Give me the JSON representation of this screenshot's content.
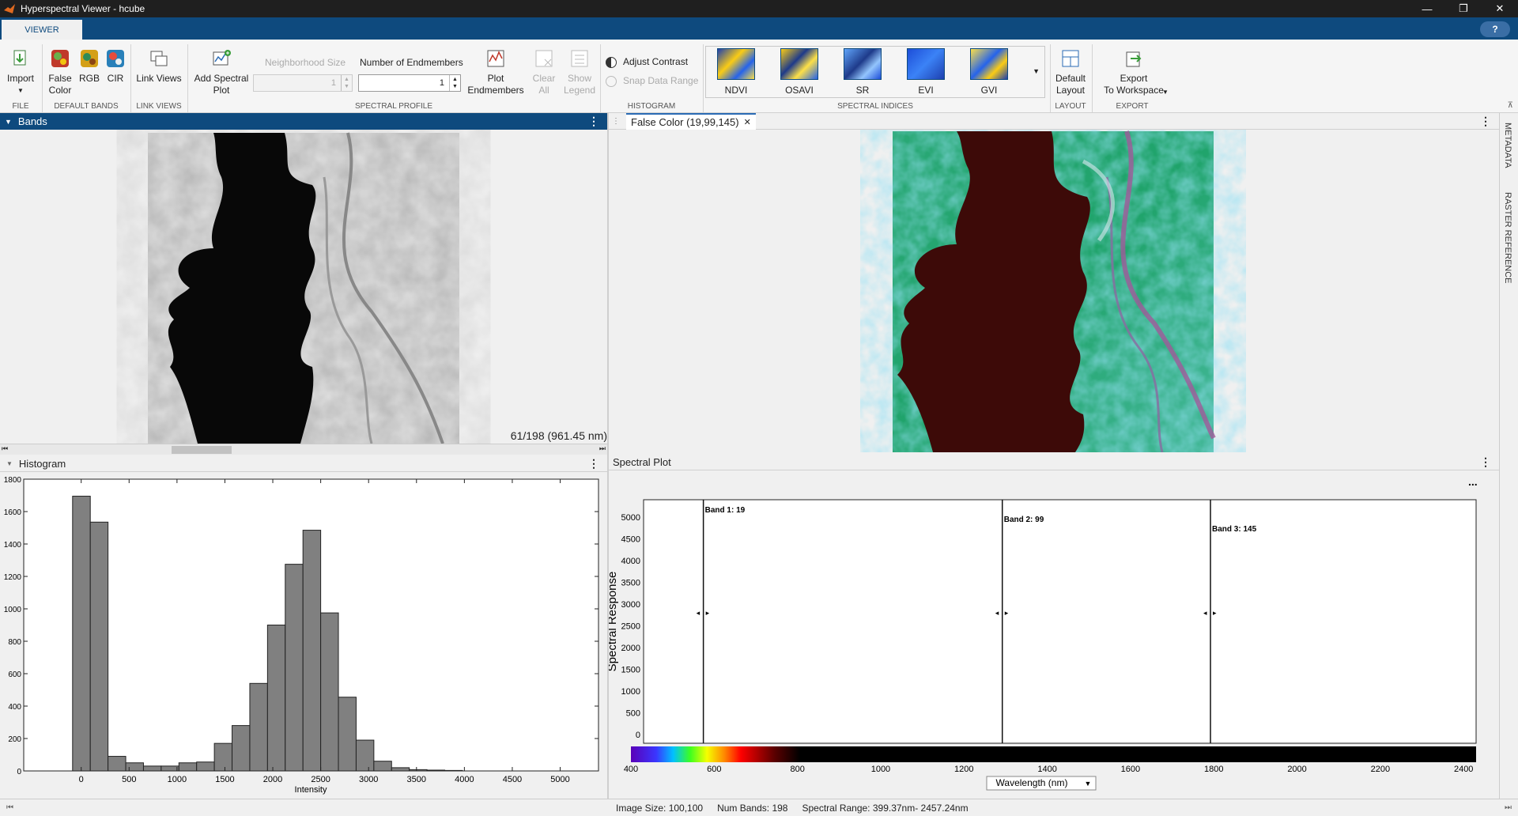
{
  "window": {
    "title": "Hyperspectral Viewer - hcube",
    "min_glyph": "—",
    "max_glyph": "❐",
    "close_glyph": "✕"
  },
  "tabs": {
    "viewer": "VIEWER",
    "help": "?"
  },
  "ribbon": {
    "import": "Import",
    "false_color": "False\nColor",
    "rgb": "RGB",
    "cir": "CIR",
    "link_views": "Link Views",
    "add_spectral_plot": "Add Spectral\nPlot",
    "neighborhood_size": "Neighborhood Size",
    "neighborhood_value": "1",
    "num_endmembers": "Number of Endmembers",
    "num_endmembers_value": "1",
    "plot_endmembers": "Plot\nEndmembers",
    "clear_all": "Clear\nAll",
    "show_legend": "Show\nLegend",
    "adjust_contrast": "Adjust Contrast",
    "snap_data_range": "Snap Data Range",
    "indices": [
      "NDVI",
      "OSAVI",
      "SR",
      "EVI",
      "GVI"
    ],
    "default_layout": "Default\nLayout",
    "export": "Export\nTo Workspace",
    "groups": {
      "file": "FILE",
      "default_bands": "DEFAULT BANDS",
      "link_views": "LINK VIEWS",
      "spectral_profile": "SPECTRAL PROFILE",
      "histogram": "HISTOGRAM",
      "spectral_indices": "SPECTRAL INDICES",
      "layout": "LAYOUT",
      "export": "EXPORT"
    }
  },
  "bands_panel": {
    "title": "Bands",
    "band_label": "61/198 (961.45 nm)"
  },
  "false_color_panel": {
    "tab_label": "False Color (19,99,145)"
  },
  "histogram_panel": {
    "title": "Histogram"
  },
  "spectral_panel": {
    "title": "Spectral Plot",
    "more": "..."
  },
  "side_tabs": {
    "metadata": "METADATA",
    "raster_reference": "RASTER REFERENCE"
  },
  "status": {
    "image_size": "Image Size: 100,100",
    "num_bands": "Num Bands: 198",
    "spectral_range": "Spectral Range: 399.37nm- 2457.24nm"
  },
  "chart_data": [
    {
      "type": "bar",
      "xlabel": "Intensity",
      "x_ticks": [
        0,
        500,
        1000,
        1500,
        2000,
        2500,
        3000,
        3500,
        4000,
        4500,
        5000
      ],
      "y_ticks": [
        0,
        200,
        400,
        600,
        800,
        1000,
        1200,
        1400,
        1600,
        1800
      ],
      "xlim": [
        -600,
        5400
      ],
      "ylim": [
        0,
        1800
      ],
      "bin_width": 185,
      "bin_starts": [
        -90,
        95,
        280,
        465,
        650,
        835,
        1020,
        1205,
        1390,
        1575,
        1760,
        1945,
        2130,
        2315,
        2500,
        2685,
        2870,
        3055,
        3240,
        3425,
        3610,
        3795
      ],
      "counts": [
        1695,
        1535,
        90,
        50,
        30,
        30,
        50,
        55,
        170,
        280,
        540,
        900,
        1275,
        1485,
        975,
        455,
        190,
        60,
        20,
        8,
        5,
        3
      ]
    },
    {
      "type": "line",
      "ylabel": "Spectral Response",
      "xlabel": "Wavelength (nm)",
      "xlim": [
        400,
        2430
      ],
      "ylim": [
        -200,
        5400
      ],
      "x_ticks": [
        400,
        600,
        800,
        1000,
        1200,
        1400,
        1600,
        1800,
        2000,
        2200,
        2400
      ],
      "y_ticks": [
        0,
        500,
        1000,
        1500,
        2000,
        2500,
        3000,
        3500,
        4000,
        4500,
        5000
      ],
      "band_markers": [
        {
          "label": "Band 1: 19",
          "wavelength": 574
        },
        {
          "label": "Band 2: 99",
          "wavelength": 1292
        },
        {
          "label": "Band 3: 145",
          "wavelength": 1792
        }
      ]
    }
  ]
}
